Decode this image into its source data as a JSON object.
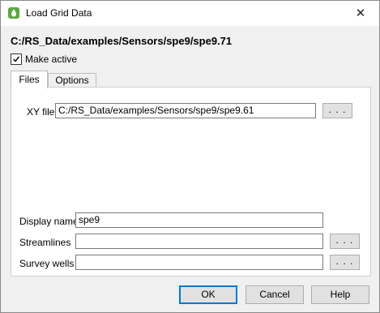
{
  "window": {
    "title": "Load Grid Data",
    "close_glyph": "✕",
    "app_icon": "drop-icon",
    "accent": "#5aa83c"
  },
  "header": {
    "path": "C:/RS_Data/examples/Sensors/spe9/spe9.71"
  },
  "make_active": {
    "label": "Make active",
    "checked": true
  },
  "tabs": [
    {
      "label": "Files",
      "selected": true
    },
    {
      "label": "Options",
      "selected": false
    }
  ],
  "files": {
    "xy_file": {
      "label": "XY file",
      "value": "C:/RS_Data/examples/Sensors/spe9/spe9.61",
      "browse": ". . ."
    },
    "display_name": {
      "label": "Display name",
      "value": "spe9"
    },
    "streamlines": {
      "label": "Streamlines",
      "value": "",
      "browse": ". . ."
    },
    "survey_wells": {
      "label": "Survey wells",
      "value": "",
      "browse": ". . ."
    }
  },
  "buttons": {
    "ok": "OK",
    "cancel": "Cancel",
    "help": "Help"
  }
}
